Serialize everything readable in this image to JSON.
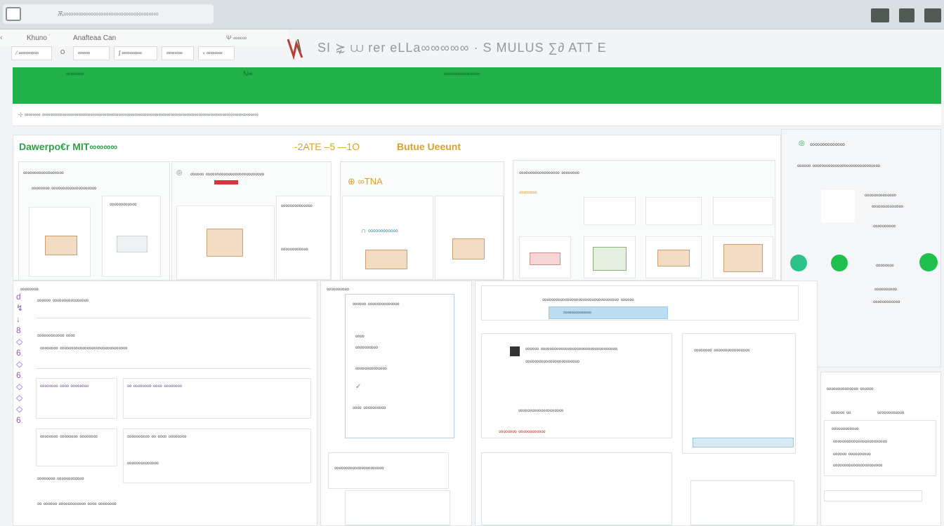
{
  "window": {
    "tab_title": "Ѫ∞∞∞∞∞∞∞∞∞∞∞∞∞∞∞∞∞∞∞"
  },
  "menu": {
    "left": "Khuno 𝄒",
    "title": "Anafteaa Can",
    "right": "Ψ ∞∞∞"
  },
  "toolbar": {
    "item1": "∕ ∞∞∞∞∞",
    "item2": "O",
    "item3": "∞∞∞",
    "item4": "∫ ∞∞∞∞∞",
    "item5": "∞∞∞∞",
    "item6": "‹ ∞∞∞∞"
  },
  "hero": {
    "title": "SI ⋩ ⩊ rer eLLa∞∞∞∞∞ · S  MULUS  ∑∂   ATT E"
  },
  "greenbar": {
    "left": "∞∞∞∞",
    "mid": "ℕ∞",
    "right": "∞∞∞∞∞∞∞∞"
  },
  "crumbs": {
    "text": "⊹ ∞∞∞∞ ∞∞∞∞∞∞∞∞∞∞∞∞∞∞∞∞∞∞∞∞∞∞∞∞∞∞∞∞∞∞∞∞∞∞∞∞∞∞∞∞∞∞∞∞∞∞∞∞∞∞∞∞∞∞"
  },
  "main_panel": {
    "heading": "Dawerpo€r  MIT∞∞∞∞",
    "date": "-2ATE –5 –-1O",
    "badge": "Butue Ueeunt"
  },
  "cards": {
    "c1_title": "∞∞∞∞∞∞∞∞∞",
    "c1_sub": "∞∞∞∞ ∞∞∞∞∞∞∞∞∞∞",
    "c1_caption": "∞∞∞∞∞∞",
    "c2_title": "∞∞∞ ∞∞∞∞∞∞∞∞∞∞∞∞∞",
    "c2_sub": "∞∞∞∞∞∞∞",
    "c2_caption": "∞∞∞∞∞∞",
    "c3_title": "⊕ ∞TNA",
    "c3_caption": "∩ ∞∞∞∞∞∞",
    "c4_title": "∞∞∞∞∞∞∞∞∞ ∞∞∞∞",
    "c4_sub": "∞∞∞∞"
  },
  "side_panel": {
    "title": "∞∞∞∞∞∞∞",
    "line1": "∞∞∞ ∞∞∞∞∞∞∞∞∞∞∞∞∞∞∞",
    "row1": "∞∞∞∞∞∞∞",
    "row2": "∞∞∞∞∞∞∞",
    "row3": "∞∞∞∞∞",
    "row4": "∞∞∞∞",
    "row5": "∞∞∞∞∞",
    "row6": "∞∞∞∞∞∞"
  },
  "form": {
    "header": "∞∞∞∞",
    "field1": "∞∞∞ ∞∞∞∞∞∞∞∞",
    "field2": "∞∞∞∞∞∞ ∞∞",
    "field3": "∞∞∞∞ ∞∞∞∞∞∞∞∞∞∞∞∞∞∞∞",
    "field4": "∞∞∞∞ ∞∞ ∞∞∞∞",
    "field5": "∞ ∞∞∞∞ ∞∞ ∞∞∞∞",
    "field6": "∞∞∞∞ ∞∞∞∞ ∞∞∞∞",
    "field7": "∞∞∞∞∞ ∞ ∞∞ ∞∞∞∞",
    "field8": "∞∞∞∞∞∞∞",
    "field9": "∞∞∞∞ ∞∞∞∞∞∞",
    "field10": "∞ ∞∞∞ ∞∞∞∞∞∞ ∞∞ ∞∞∞∞"
  },
  "chat": {
    "header": "∞∞∞∞∞",
    "m1": "∞∞∞ ∞∞∞∞∞∞∞",
    "m2": "∞∞",
    "m3": "∞∞∞∞∞",
    "m4": "∞∞∞∞∞∞∞",
    "m5": "∞∞ ∞∞∞∞∞",
    "m6": "∞∞∞∞∞∞∞∞∞∞∞"
  },
  "right_cards": {
    "search": "∞∞∞∞∞∞∞∞∞∞∞∞∞∞∞∞∞ ∞∞∞",
    "btn": "∞∞∞∞∞∞∞",
    "r1": "∞∞∞ ∞∞∞∞∞∞∞∞∞∞∞∞∞∞∞∞∞",
    "r2": "∞∞∞∞∞∞∞∞∞∞∞∞",
    "r3": "∞∞∞∞∞∞∞∞∞∞",
    "r4": "∞∞∞∞ ∞∞∞∞∞∞",
    "r5": "∞∞∞∞ ∞∞∞∞∞∞∞∞"
  },
  "sidebar_bottom": {
    "title": "∞∞∞∞∞∞∞ ∞∞∞",
    "tabs1": "∞∞∞ ∞",
    "tabs2": "∞∞∞∞∞∞",
    "r1": "∞∞∞∞∞∞",
    "r2": "∞∞∞∞∞∞∞∞∞∞∞∞",
    "r3": "∞∞∞ ∞∞∞∞∞",
    "r4": "∞∞∞∞∞∞∞∞∞∞∞"
  },
  "colors": {
    "brand_green": "#23b24a",
    "accent_gold": "#d8a22a",
    "alert_red": "#d6333a"
  }
}
